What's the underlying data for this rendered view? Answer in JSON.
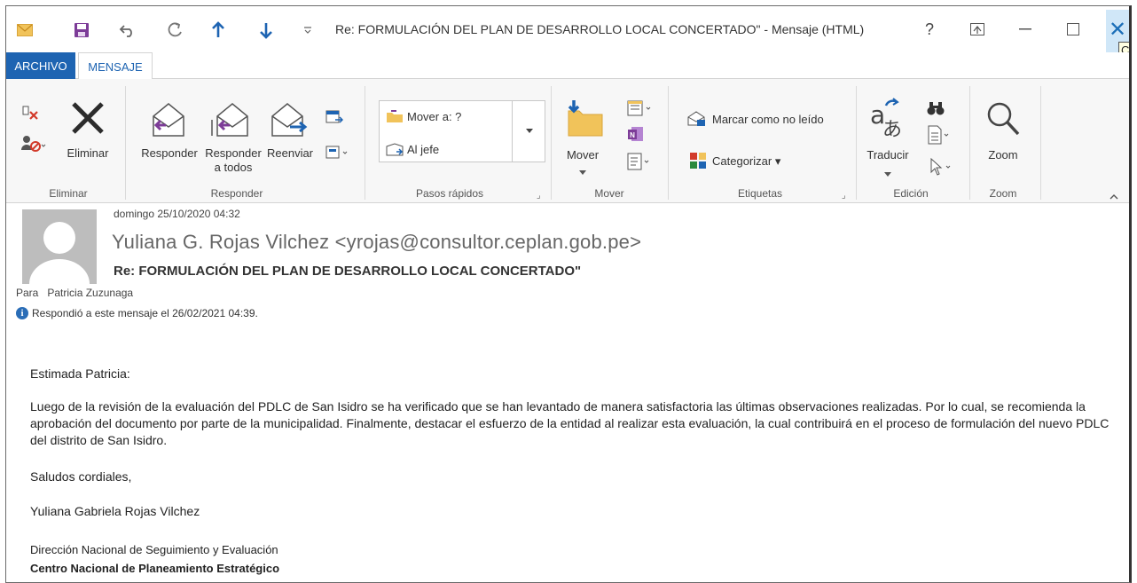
{
  "window": {
    "title": "Re: FORMULACIÓN DEL PLAN DE DESARROLLO LOCAL CONCERTADO\" - Mensaje (HTML)",
    "help": "?",
    "tooltip_fragment": "Ce"
  },
  "tabs": {
    "archivo": "ARCHIVO",
    "mensaje": "MENSAJE"
  },
  "ribbon": {
    "eliminar_group": {
      "label": "Eliminar",
      "delete_button": "Eliminar"
    },
    "responder_group": {
      "label": "Responder",
      "reply": "Responder",
      "reply_all_line1": "Responder",
      "reply_all_line2": "a todos",
      "forward": "Reenviar"
    },
    "pasos_group": {
      "label": "Pasos rápidos",
      "mover_a": "Mover a: ?",
      "al_jefe": "Al jefe"
    },
    "mover_group": {
      "label": "Mover",
      "mover": "Mover"
    },
    "etiquetas_group": {
      "label": "Etiquetas",
      "mark_unread": "Marcar como no leído",
      "categorize": "Categorizar"
    },
    "edicion_group": {
      "label": "Edición",
      "translate": "Traducir"
    },
    "zoom_group": {
      "label": "Zoom",
      "zoom": "Zoom"
    }
  },
  "message": {
    "date": "domingo 25/10/2020 04:32",
    "from": "Yuliana G. Rojas Vilchez <yrojas@consultor.ceplan.gob.pe>",
    "subject": "Re: FORMULACIÓN DEL PLAN DE DESARROLLO LOCAL CONCERTADO\"",
    "to_label": "Para",
    "to": "Patricia Zuzunaga",
    "info": "Respondió a este mensaje el 26/02/2021 04:39."
  },
  "body": {
    "greeting": "Estimada Patricia:",
    "paragraph": "Luego de la revisión de la evaluación del PDLC de San Isidro se ha verificado que se han levantado de manera satisfactoria las últimas observaciones realizadas. Por lo cual, se recomienda la aprobación del documento por parte de la municipalidad. Finalmente, destacar el esfuerzo de la entidad al realizar esta evaluación, la cual contribuirá en el proceso de formulación del nuevo PDLC del distrito de San Isidro.",
    "closing": "Saludos cordiales,",
    "signature_name": "Yuliana Gabriela Rojas Vilchez",
    "department": "Dirección Nacional de Seguimiento y Evaluación",
    "organization": "Centro Nacional de Planeamiento Estratégico"
  },
  "colors": {
    "accent": "#1e64b2",
    "close_hover": "#d0e7f8"
  }
}
